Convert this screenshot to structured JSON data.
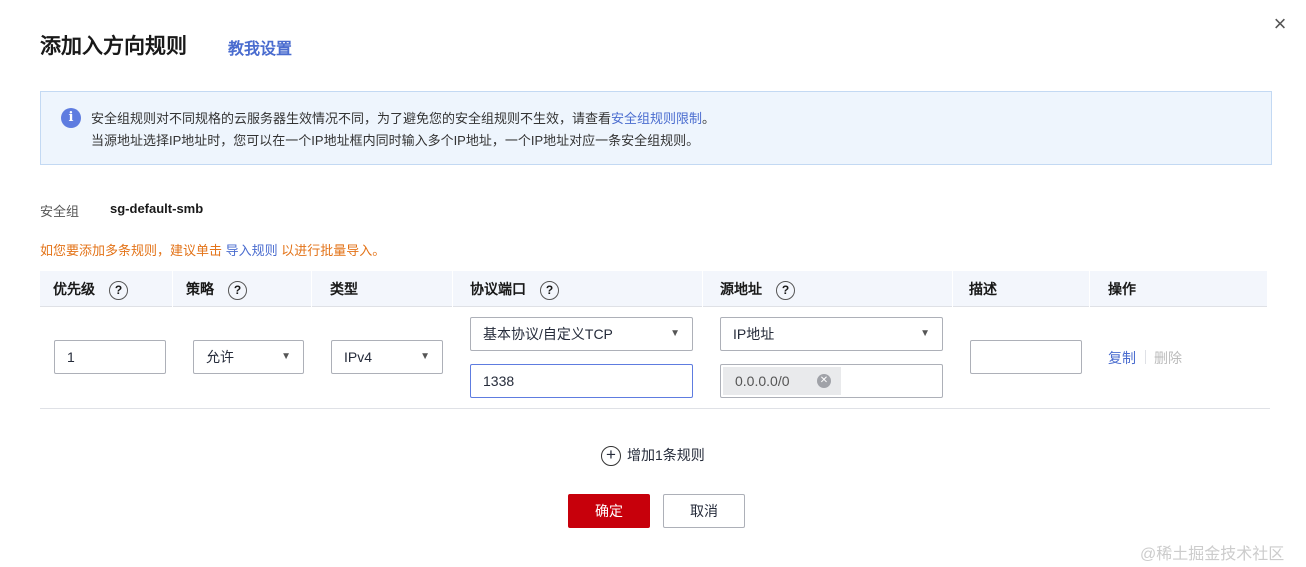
{
  "dialog": {
    "title": "添加入方向规则",
    "help_link": "教我设置",
    "close_icon": "×"
  },
  "info": {
    "line1_prefix": "安全组规则对不同规格的云服务器生效情况不同，为了避免您的安全组规则不生效，请查看",
    "line1_link": "安全组规则限制",
    "line1_suffix": "。",
    "line2": "当源地址选择IP地址时，您可以在一个IP地址框内同时输入多个IP地址，一个IP地址对应一条安全组规则。"
  },
  "security_group": {
    "label": "安全组",
    "value": "sg-default-smb"
  },
  "notice": {
    "prefix": "如您要添加多条规则，建议单击 ",
    "link": "导入规则",
    "suffix": " 以进行批量导入。"
  },
  "table": {
    "headers": [
      "优先级",
      "策略",
      "类型",
      "协议端口",
      "源地址",
      "描述",
      "操作"
    ],
    "row": {
      "priority": "1",
      "policy": "允许",
      "type": "IPv4",
      "protocol": "基本协议/自定义TCP",
      "port": "1338",
      "source_type": "IP地址",
      "source_ip": "0.0.0.0/0",
      "description": "",
      "copy": "复制",
      "delete": "删除"
    }
  },
  "add_rule": "增加1条规则",
  "buttons": {
    "ok": "确定",
    "cancel": "取消"
  },
  "watermark": "@稀土掘金技术社区",
  "colors": {
    "primary": "#c7000b",
    "link": "#4a6ccf",
    "warning": "#e37318"
  }
}
